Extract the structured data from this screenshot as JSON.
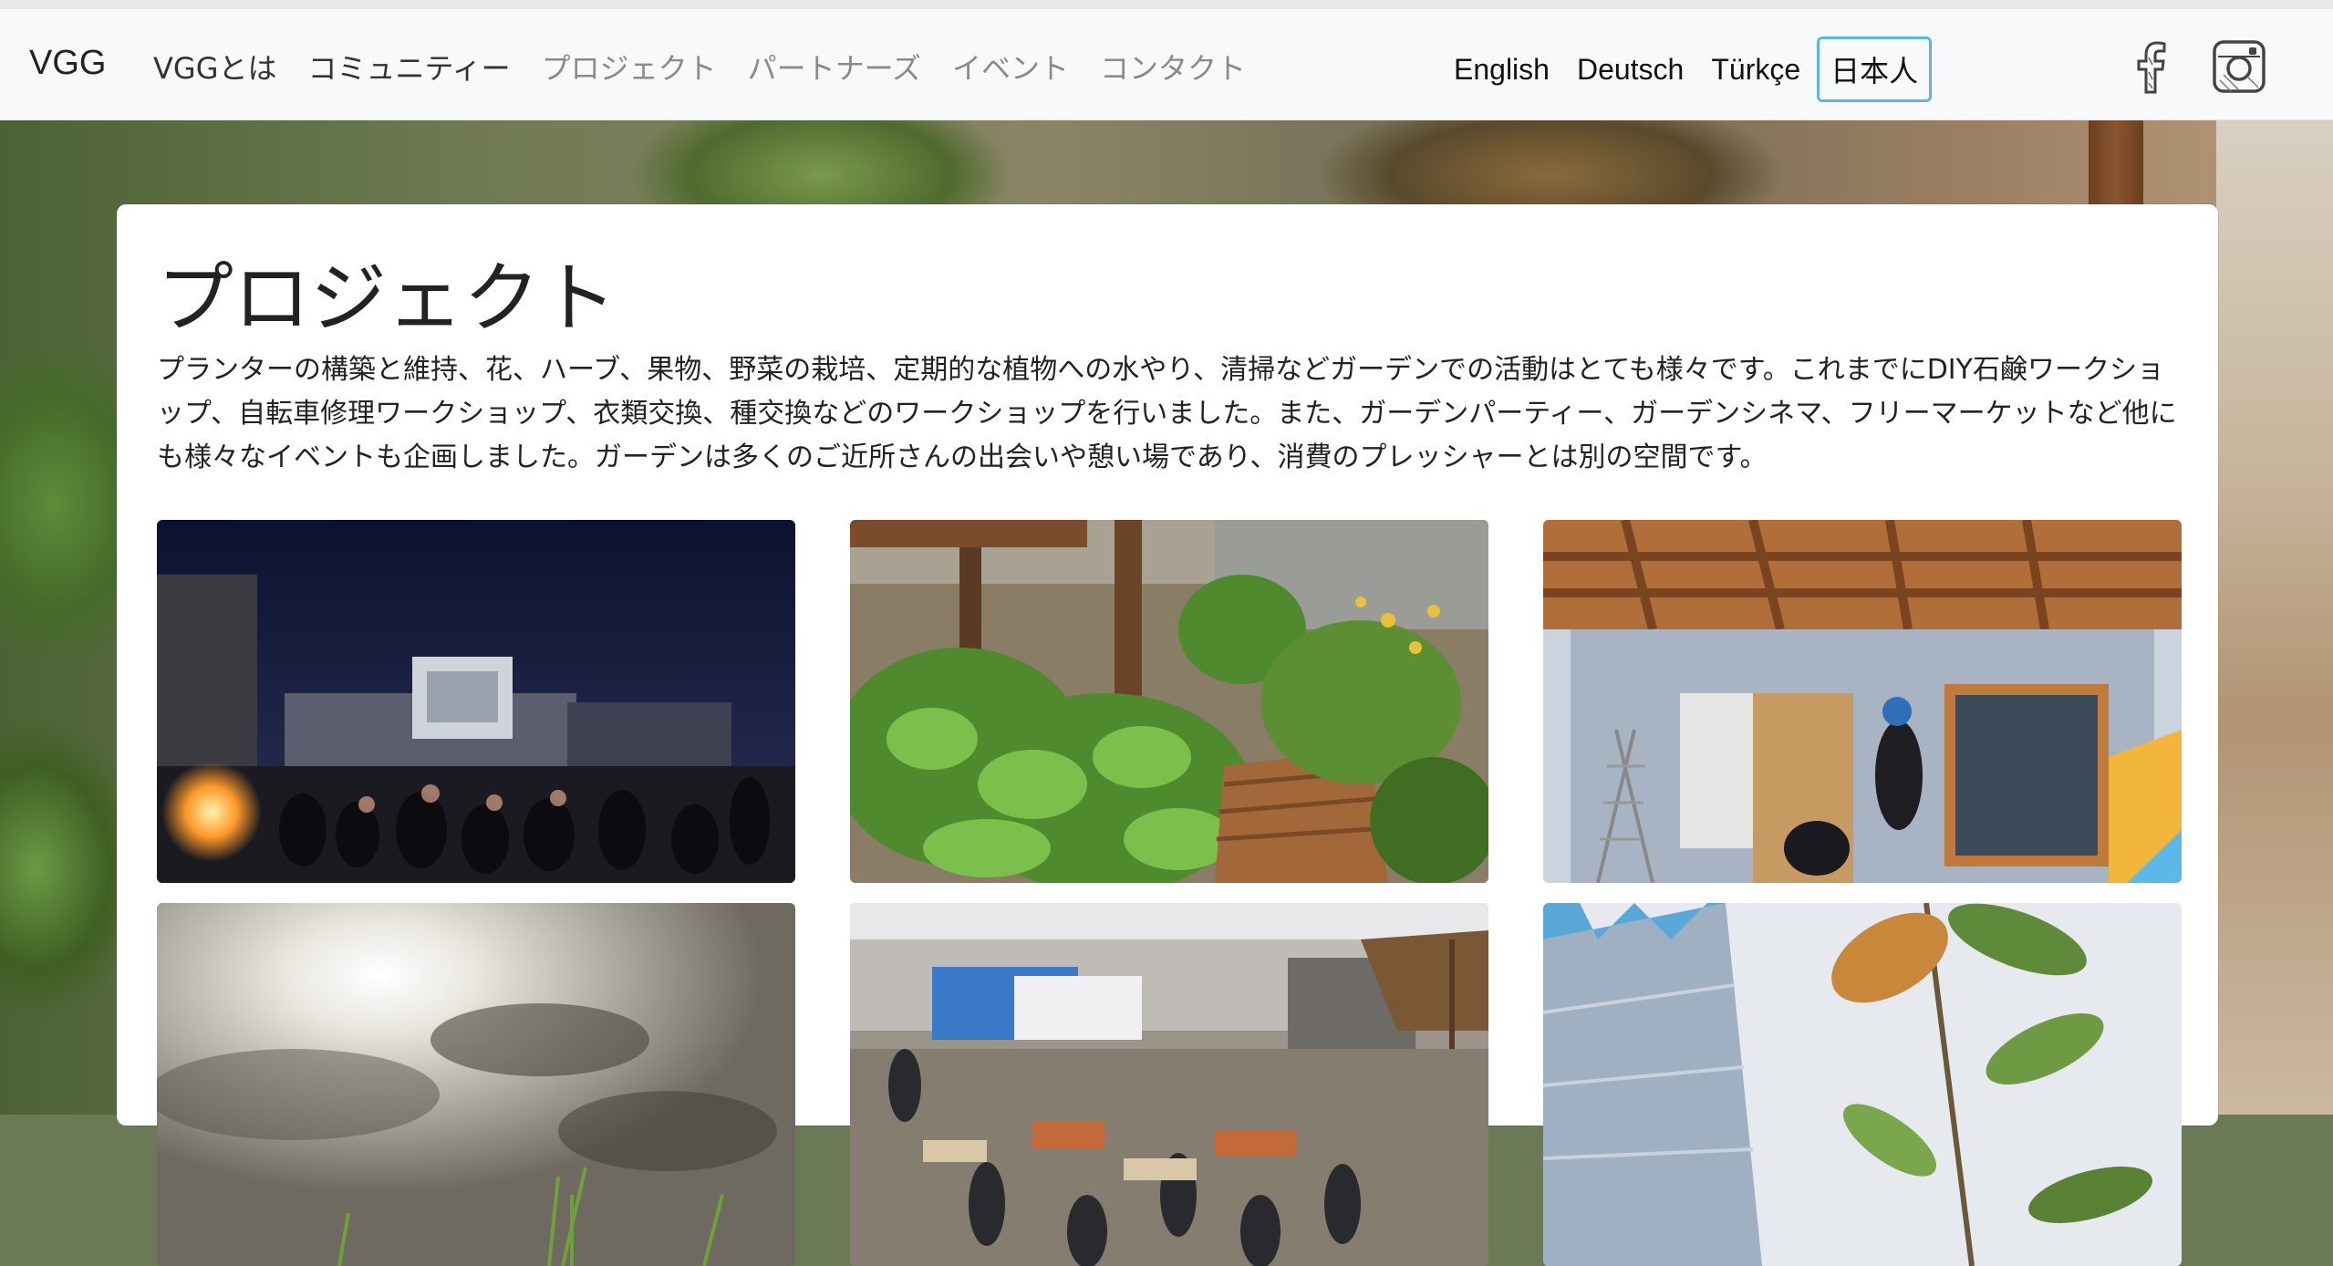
{
  "brand": "VGG",
  "nav": {
    "items": [
      {
        "label": "VGGとは",
        "muted": false
      },
      {
        "label": "コミュニティー",
        "muted": false
      },
      {
        "label": "プロジェクト",
        "muted": true
      },
      {
        "label": "パートナーズ",
        "muted": true
      },
      {
        "label": "イベント",
        "muted": true
      },
      {
        "label": "コンタクト",
        "muted": true
      }
    ]
  },
  "languages": [
    {
      "label": "English",
      "active": false
    },
    {
      "label": "Deutsch",
      "active": false
    },
    {
      "label": "Türkçe",
      "active": false
    },
    {
      "label": "日本人",
      "active": true
    }
  ],
  "social": {
    "facebook_icon": "facebook-icon",
    "instagram_icon": "instagram-icon"
  },
  "main": {
    "title": "プロジェクト",
    "intro": "プランターの構築と維持、花、ハーブ、果物、野菜の栽培、定期的な植物への水やり、清掃などガーデンでの活動はとても様々です。これまでにDIY石鹸ワークショップ、自転車修理ワークショップ、衣類交換、種交換などのワークショップを行いました。また、ガーデンパーティー、ガーデンシネマ、フリーマーケットなど他にも様々なイベントも企画しました。ガーデンは多くのご近所さんの出会いや憩い場であり、消費のプレッシャーとは別の空間です。"
  },
  "colors": {
    "active_lang_border": "#5bb7e6",
    "muted_nav": "#8a8a8a",
    "text": "#222222"
  }
}
